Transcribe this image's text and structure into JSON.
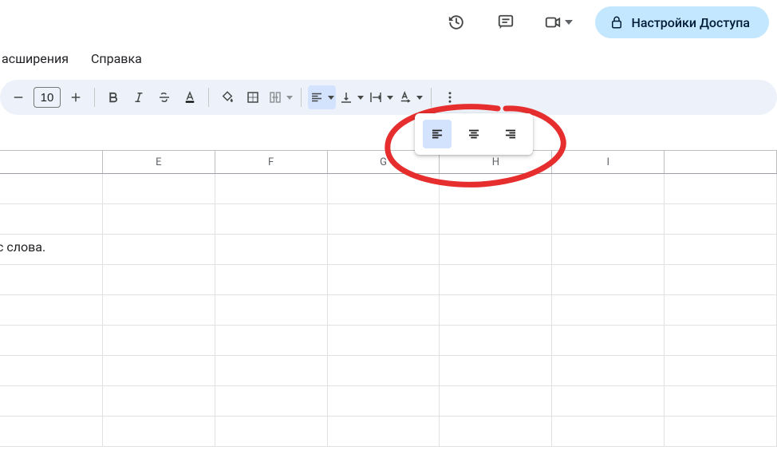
{
  "menus": {
    "extensions": "асширения",
    "help": "Справка"
  },
  "share": {
    "label": "Настройки Доступа"
  },
  "toolbar": {
    "font_size": "10"
  },
  "columns": [
    "",
    "E",
    "F",
    "G",
    "H",
    "I",
    ""
  ],
  "cells": {
    "r3_c0": "с слова."
  }
}
